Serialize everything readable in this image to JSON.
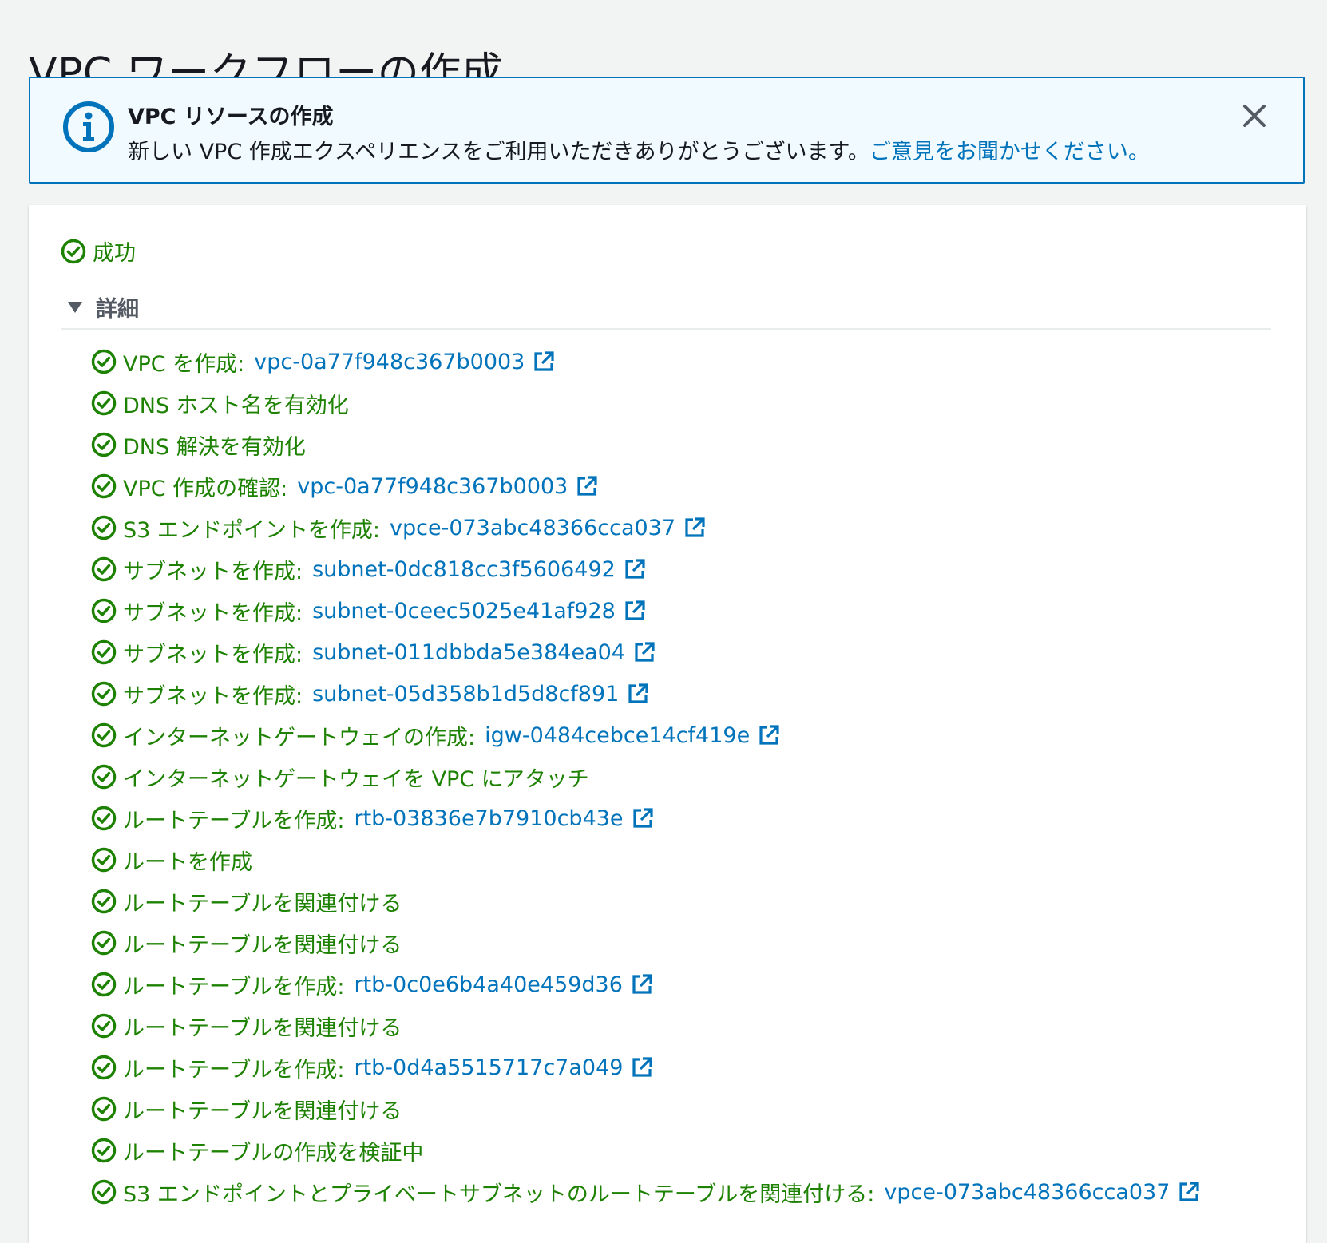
{
  "page": {
    "title": "VPC ワークフローの作成"
  },
  "flash": {
    "title": "VPC リソースの作成",
    "message": "新しい VPC 作成エクスペリエンスをご利用いただきありがとうございます。",
    "feedback_link": "ご意見をお聞かせください。",
    "icon": "info-icon",
    "close_icon": "close-icon"
  },
  "status": {
    "label": "成功",
    "icon": "check-circle-icon"
  },
  "details": {
    "label": "詳細",
    "expanded": true,
    "steps": [
      {
        "label": "VPC を作成:",
        "resource": "vpc-0a77f948c367b0003"
      },
      {
        "label": "DNS ホスト名を有効化",
        "resource": ""
      },
      {
        "label": "DNS 解決を有効化",
        "resource": ""
      },
      {
        "label": "VPC 作成の確認:",
        "resource": "vpc-0a77f948c367b0003"
      },
      {
        "label": "S3 エンドポイントを作成:",
        "resource": "vpce-073abc48366cca037"
      },
      {
        "label": "サブネットを作成:",
        "resource": "subnet-0dc818cc3f5606492"
      },
      {
        "label": "サブネットを作成:",
        "resource": "subnet-0ceec5025e41af928"
      },
      {
        "label": "サブネットを作成:",
        "resource": "subnet-011dbbda5e384ea04"
      },
      {
        "label": "サブネットを作成:",
        "resource": "subnet-05d358b1d5d8cf891"
      },
      {
        "label": "インターネットゲートウェイの作成:",
        "resource": "igw-0484cebce14cf419e"
      },
      {
        "label": "インターネットゲートウェイを VPC にアタッチ",
        "resource": ""
      },
      {
        "label": "ルートテーブルを作成:",
        "resource": "rtb-03836e7b7910cb43e"
      },
      {
        "label": "ルートを作成",
        "resource": ""
      },
      {
        "label": "ルートテーブルを関連付ける",
        "resource": ""
      },
      {
        "label": "ルートテーブルを関連付ける",
        "resource": ""
      },
      {
        "label": "ルートテーブルを作成:",
        "resource": "rtb-0c0e6b4a40e459d36"
      },
      {
        "label": "ルートテーブルを関連付ける",
        "resource": ""
      },
      {
        "label": "ルートテーブルを作成:",
        "resource": "rtb-0d4a5515717c7a049"
      },
      {
        "label": "ルートテーブルを関連付ける",
        "resource": ""
      },
      {
        "label": "ルートテーブルの作成を検証中",
        "resource": ""
      },
      {
        "label": "S3 エンドポイントとプライベートサブネットのルートテーブルを関連付ける:",
        "resource": "vpce-073abc48366cca037"
      }
    ]
  },
  "colors": {
    "success": "#1d8102",
    "link": "#0073bb",
    "info_border": "#0073bb",
    "info_bg": "#f1faff",
    "page_bg": "#f2f3f3"
  }
}
